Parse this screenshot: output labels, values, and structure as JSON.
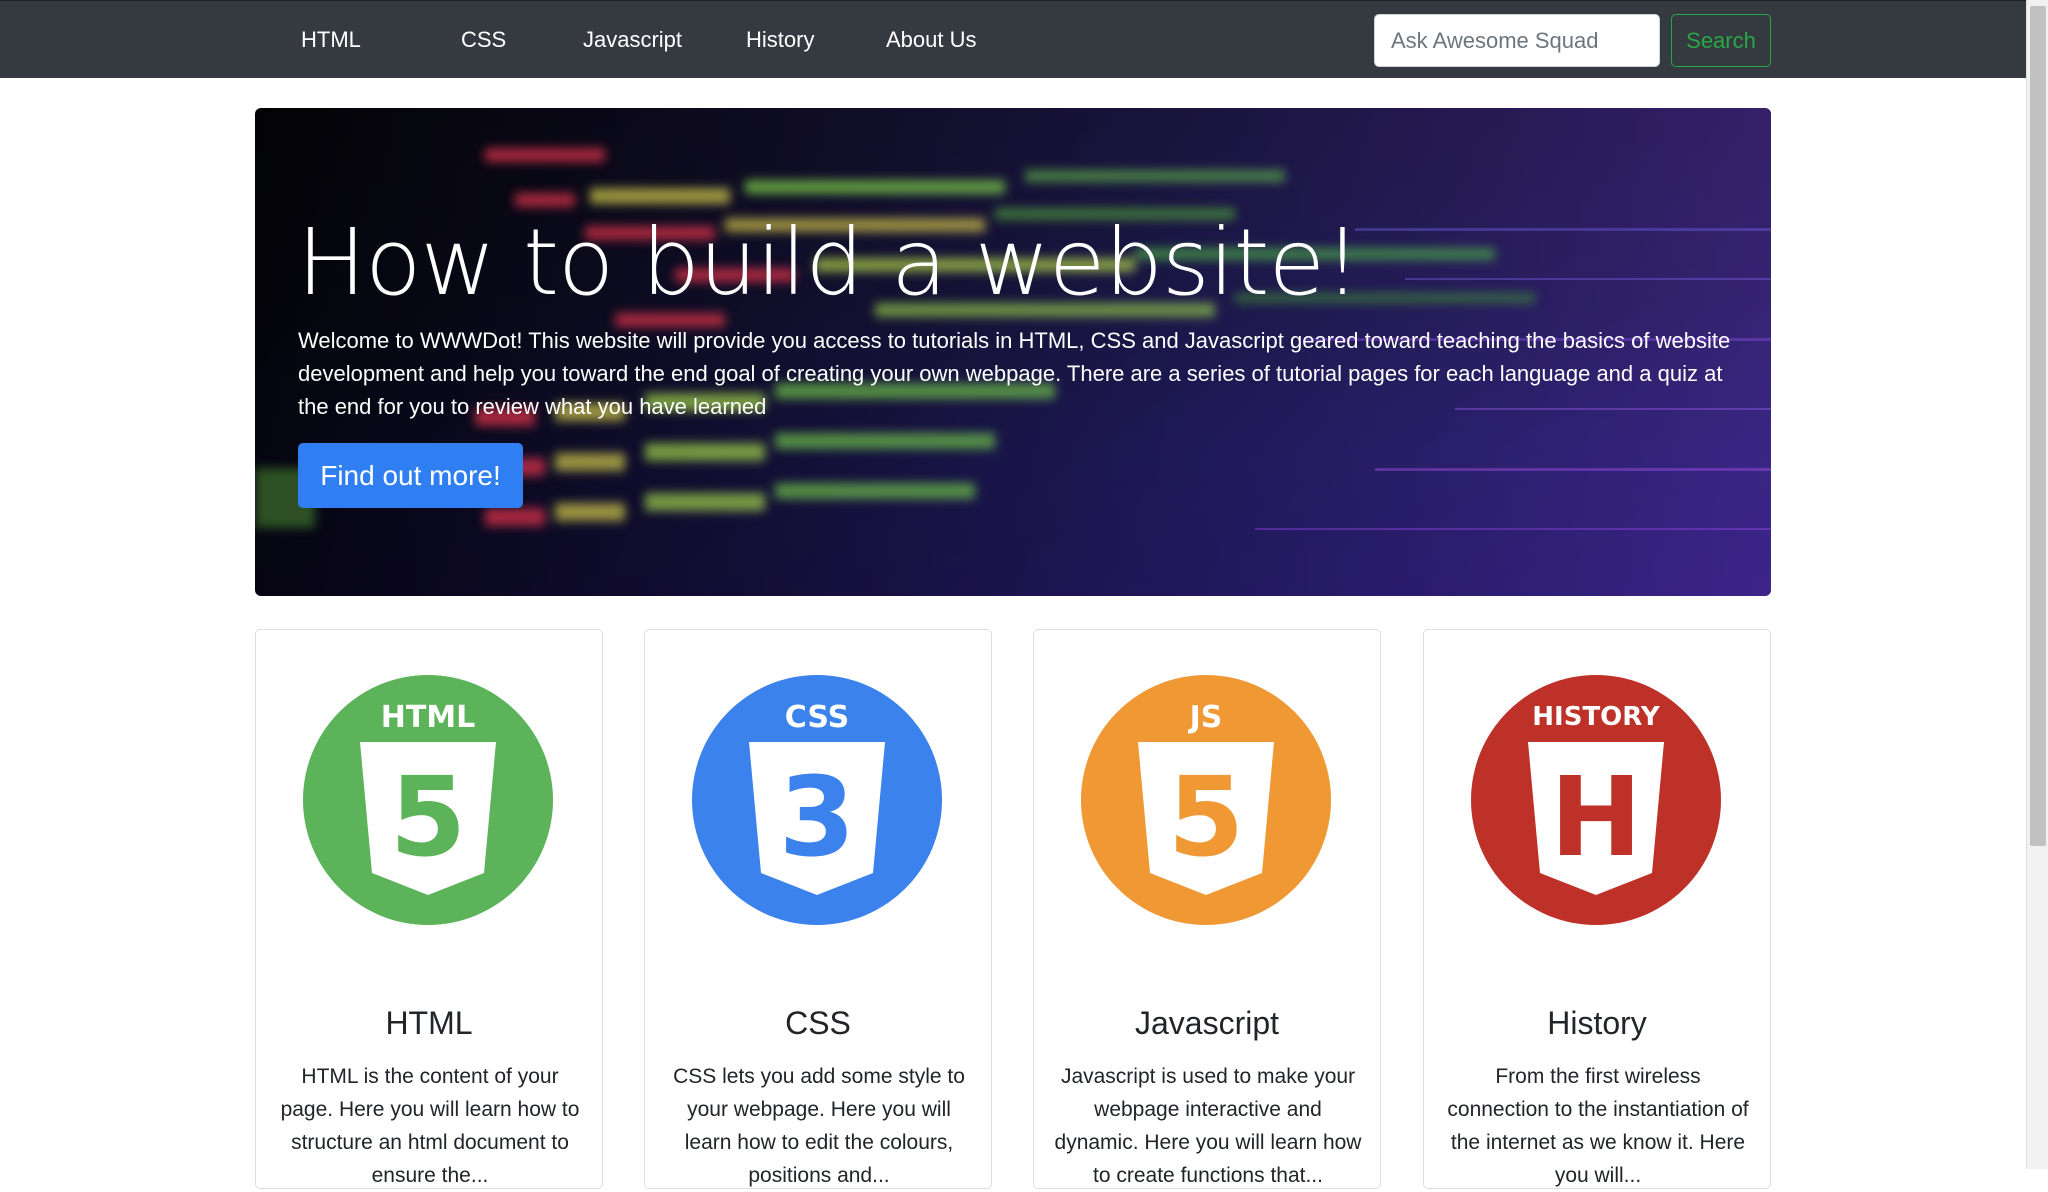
{
  "nav": {
    "items": [
      {
        "label": "HTML"
      },
      {
        "label": "CSS"
      },
      {
        "label": "Javascript"
      },
      {
        "label": "History"
      },
      {
        "label": "About Us"
      }
    ],
    "search_placeholder": "Ask Awesome Squad",
    "search_label": "Search"
  },
  "jumbotron": {
    "title": "How to build a website!",
    "lead": "Welcome to WWWDot! This website will provide you access to tutorials in HTML, CSS and Javascript geared toward teaching the basics of website development and help you toward the end goal of creating your own webpage. There are a series of tutorial pages for each language and a quiz at the end for you to review what you have learned",
    "button_label": "Find out more!"
  },
  "cards": [
    {
      "logo_text": "HTML",
      "logo_glyph": "5",
      "color": "#5cb359",
      "title": "HTML",
      "text": "HTML is the content of your page. Here you will learn how to structure an html document to ensure the..."
    },
    {
      "logo_text": "CSS",
      "logo_glyph": "3",
      "color": "#3b82ec",
      "title": "CSS",
      "text": "CSS lets you add some style to your webpage. Here you will learn how to edit the colours, positions and..."
    },
    {
      "logo_text": "JS",
      "logo_glyph": "5",
      "color": "#ef9834",
      "title": "Javascript",
      "text": "Javascript is used to make your webpage interactive and dynamic. Here you will learn how to create functions that..."
    },
    {
      "logo_text": "HISTORY",
      "logo_glyph": "H",
      "color": "#be3128",
      "title": "History",
      "text": "From the first wireless connection to the instantiation of the internet as we know it. Here you will..."
    }
  ]
}
